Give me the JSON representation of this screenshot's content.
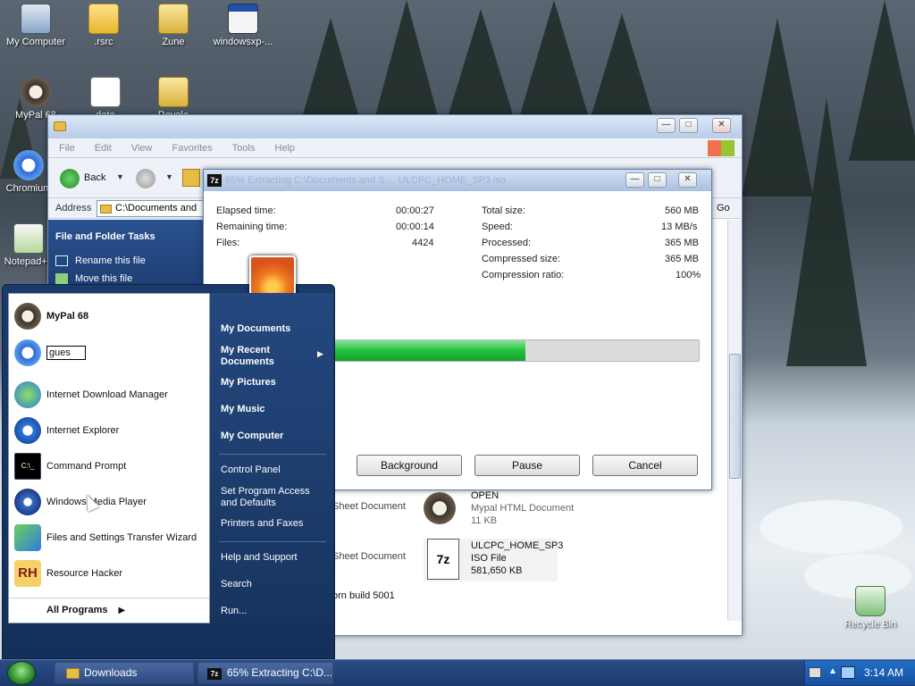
{
  "desktop": {
    "icons": [
      {
        "label": "My Computer"
      },
      {
        "label": ".rsrc"
      },
      {
        "label": "Zune"
      },
      {
        "label": "windowsxp-..."
      },
      {
        "label": "MyPal 68"
      },
      {
        "label": "data"
      },
      {
        "label": "Royale"
      },
      {
        "label": "Chromium"
      },
      {
        "label": "Notepad++"
      },
      {
        "label": "Recycle Bin"
      }
    ]
  },
  "explorer": {
    "menu": [
      "File",
      "Edit",
      "View",
      "Favorites",
      "Tools",
      "Help"
    ],
    "back_label": "Back",
    "address_label": "Address",
    "address_value": "C:\\Documents and",
    "go_label": "Go",
    "tasks_title": "File and Folder Tasks",
    "tasks": [
      "Rename this file",
      "Move this file"
    ],
    "files": [
      {
        "name": "",
        "type": "Sheet Document",
        "size": ""
      },
      {
        "name": "OPEN",
        "type": "Mypal HTML Document",
        "size": "11 KB"
      },
      {
        "name": "",
        "type": "Sheet Document",
        "size": ""
      },
      {
        "name": "ULCPC_HOME_SP3",
        "type": "ISO File",
        "size": "581,650 KB"
      }
    ],
    "status_fragment": "orn build 5001"
  },
  "extract_dialog": {
    "title": "65% Extracting C:\\Documents and S ... ULCPC_HOME_SP3.iso",
    "progress": 0.65,
    "left_stats": [
      {
        "label": "Elapsed time:",
        "value": "00:00:27"
      },
      {
        "label": "Remaining time:",
        "value": "00:00:14"
      },
      {
        "label": "Files:",
        "value": "4424"
      }
    ],
    "right_stats": [
      {
        "label": "Total size:",
        "value": "560 MB"
      },
      {
        "label": "Speed:",
        "value": "13 MB/s"
      },
      {
        "label": "Processed:",
        "value": "365 MB"
      },
      {
        "label": "Compressed size:",
        "value": "365 MB"
      },
      {
        "label": "Compression ratio:",
        "value": "100%"
      }
    ],
    "buttons": {
      "background": "Background",
      "pause": "Pause",
      "cancel": "Cancel"
    }
  },
  "start_menu": {
    "user": "MyPal 68",
    "search_value": "gues",
    "left_items": [
      "Internet Download Manager",
      "Internet Explorer",
      "Command Prompt",
      "Windows Media Player",
      "Files and Settings Transfer Wizard",
      "Resource Hacker"
    ],
    "all_programs": "All Programs",
    "right_items": [
      "My Documents",
      "My Recent Documents",
      "My Pictures",
      "My Music",
      "My Computer",
      "Control Panel",
      "Set Program Access and Defaults",
      "Printers and Faxes",
      "Help and Support",
      "Search",
      "Run..."
    ]
  },
  "taskbar": {
    "buttons": [
      "Downloads",
      "65% Extracting C:\\D..."
    ],
    "clock": "3:14 AM"
  },
  "colors": {
    "progress": "#22c23f",
    "taskbar": "#1d3a6e",
    "start_orb": "#2d8c2d"
  }
}
